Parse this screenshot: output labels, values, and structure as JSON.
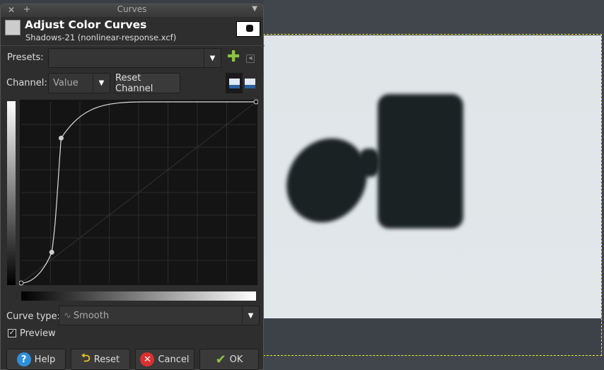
{
  "dialog": {
    "window_title": "Curves",
    "title": "Adjust Color Curves",
    "subtitle": "Shadows-21 (nonlinear-response.xcf)"
  },
  "presets": {
    "label": "Presets:",
    "value": ""
  },
  "channel": {
    "label": "Channel:",
    "value": "Value",
    "reset_label": "Reset Channel"
  },
  "curve": {
    "points": [
      [
        0,
        0
      ],
      [
        0.13,
        0.17
      ],
      [
        0.17,
        0.8
      ],
      [
        1,
        1
      ]
    ]
  },
  "curve_type": {
    "label": "Curve type:",
    "value": "Smooth"
  },
  "preview": {
    "label": "Preview",
    "checked": true
  },
  "buttons": {
    "help": "Help",
    "reset": "Reset",
    "cancel": "Cancel",
    "ok": "OK"
  },
  "colors": {
    "selection": "#e8e830",
    "ok_check": "#8cc63f",
    "help": "#2f8fdc",
    "cancel": "#d93030"
  }
}
